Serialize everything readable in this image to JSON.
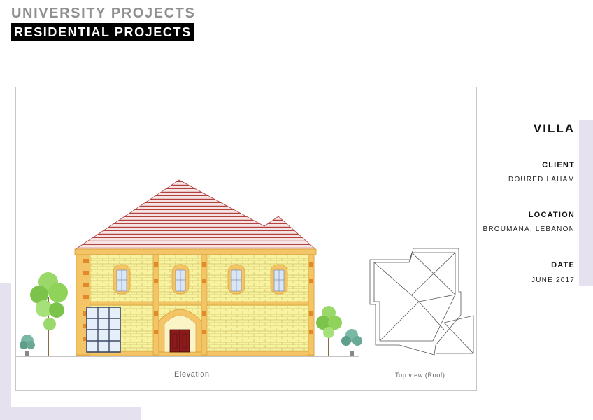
{
  "header": {
    "line1": "UNIVERSITY PROJECTS",
    "line2": "RESIDENTIAL PROJECTS"
  },
  "project": {
    "title": "VILLA",
    "client_label": "CLIENT",
    "client": "DOURED LAHAM",
    "location_label": "LOCATION",
    "location": "BROUMANA, LEBANON",
    "date_label": "DATE",
    "date": "JUNE 2017"
  },
  "drawing": {
    "elevation_caption": "Elevation",
    "roof_caption": "Top view (Roof)"
  },
  "colors": {
    "stone": "#f7f3a0",
    "trim": "#e8a13a",
    "roof": "#b5413f",
    "door": "#8b1a1a",
    "accent_bg": "#e6e1ef"
  }
}
